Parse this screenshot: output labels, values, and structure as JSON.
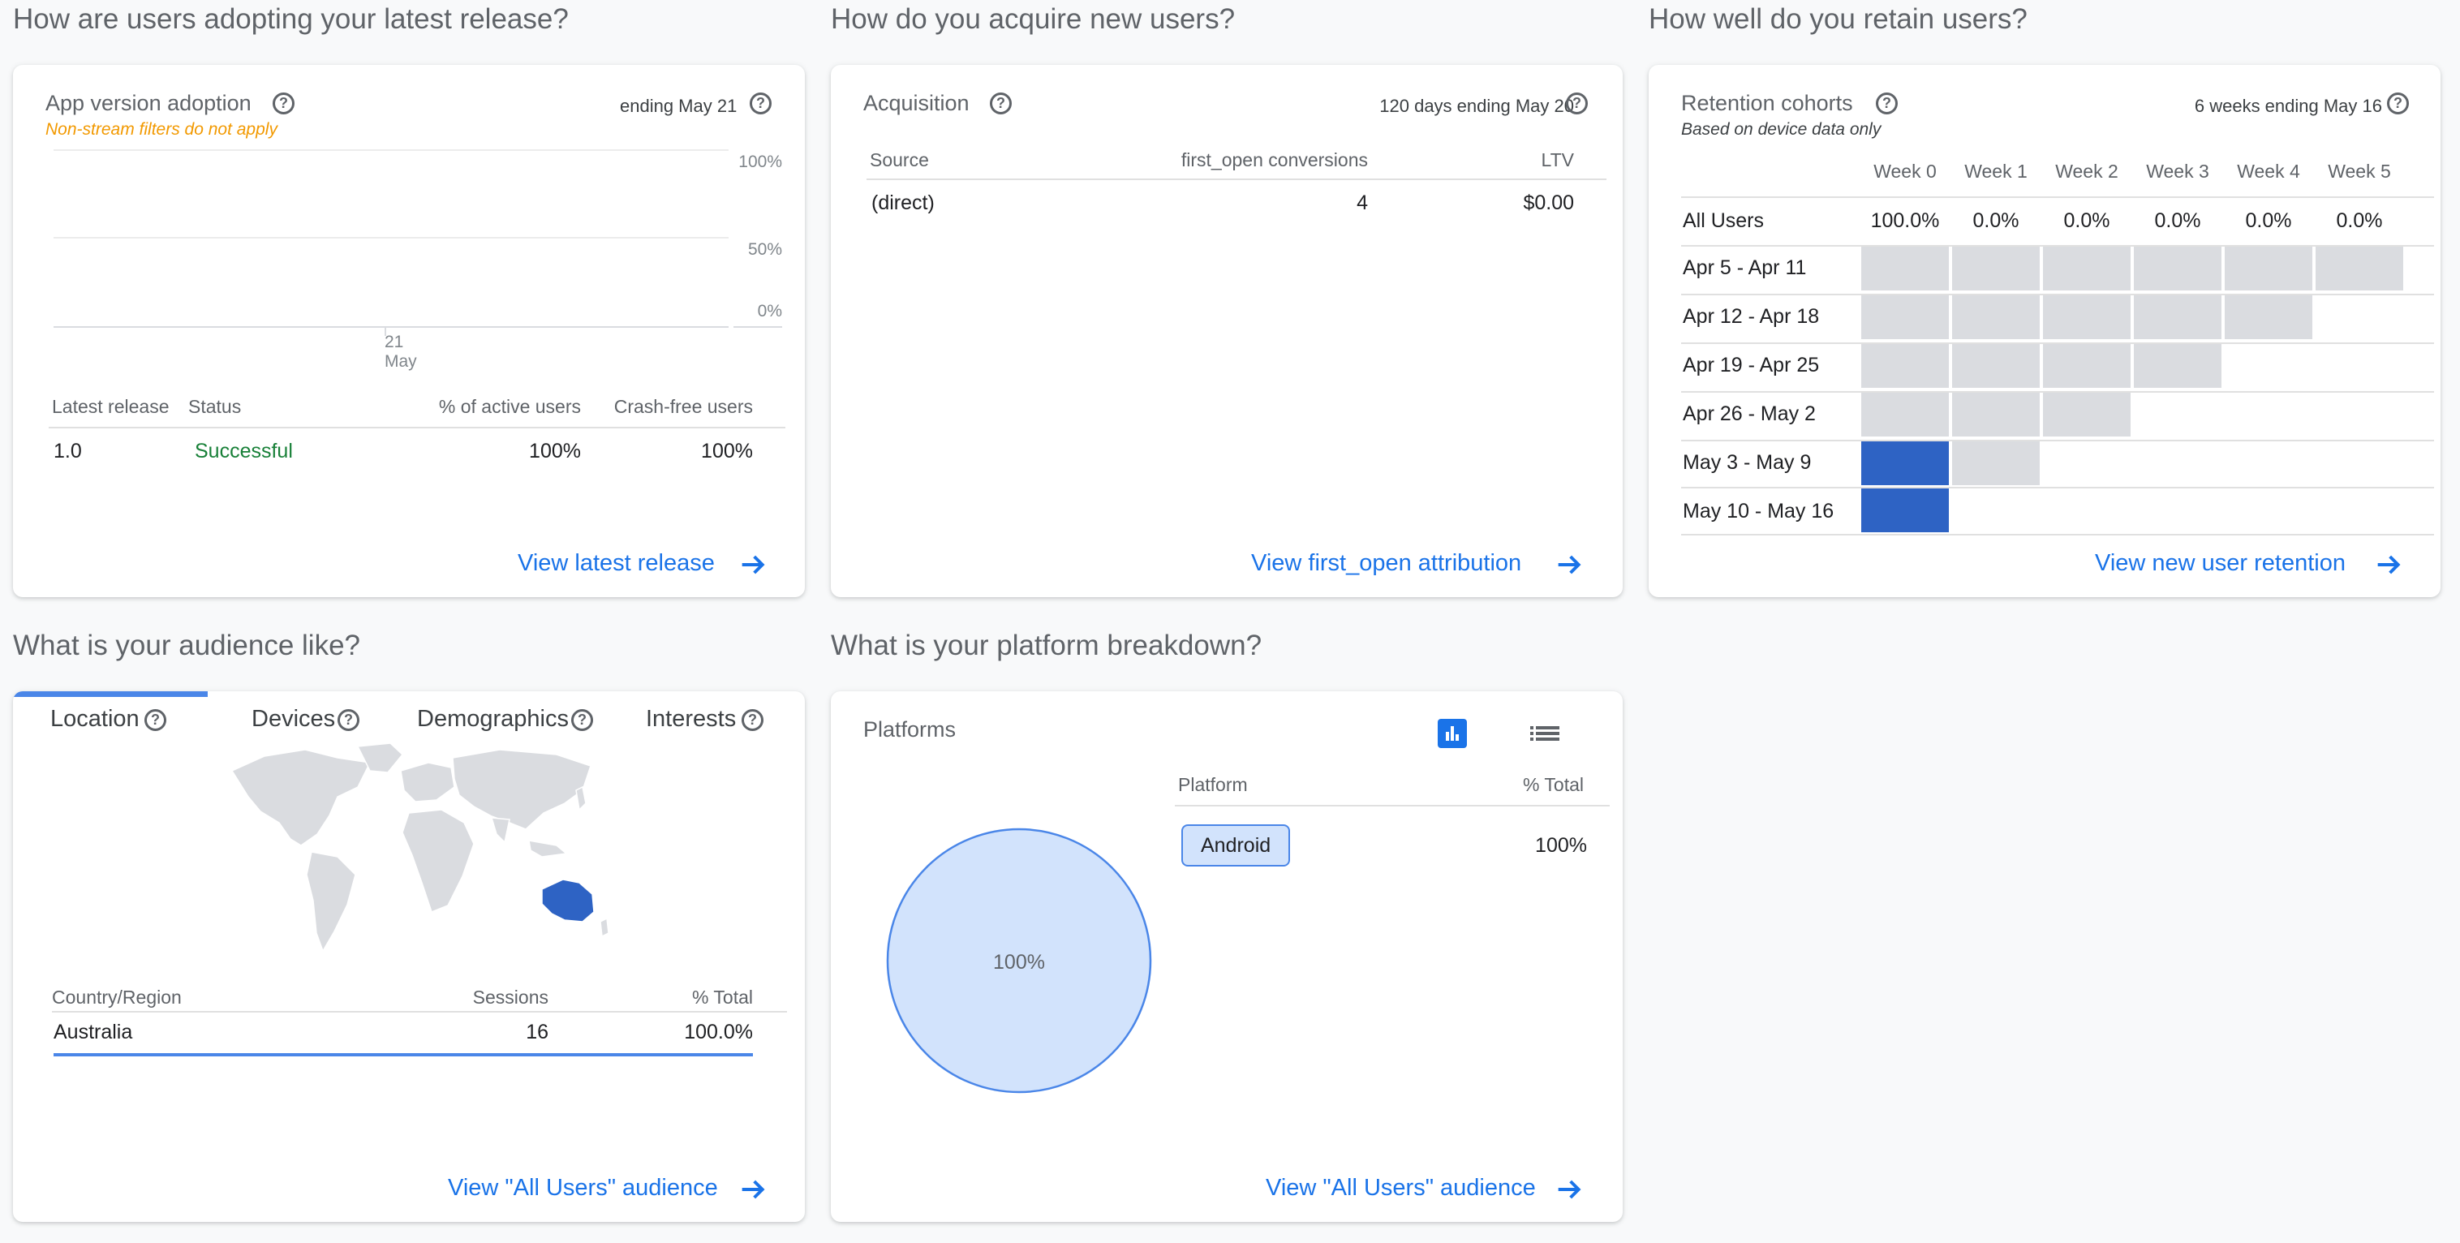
{
  "sections": {
    "adoption": "How are users adopting your latest release?",
    "acquisition": "How do you acquire new users?",
    "retention": "How well do you retain users?",
    "audience": "What is your audience like?",
    "platform": "What is your platform breakdown?"
  },
  "adoption_card": {
    "title": "App version adoption",
    "date": "ending May 21",
    "warning": "Non-stream filters do not apply",
    "y_ticks": [
      "100%",
      "50%",
      "0%"
    ],
    "x_tick_day": "21",
    "x_tick_month": "May",
    "columns": [
      "Latest release",
      "Status",
      "% of active users",
      "Crash-free users"
    ],
    "row": {
      "release": "1.0",
      "status": "Successful",
      "active": "100%",
      "crash_free": "100%"
    },
    "link": "View latest release",
    "colors": {
      "warning": "#f29900",
      "status_ok": "#188038"
    }
  },
  "acquisition_card": {
    "title": "Acquisition",
    "date": "120 days ending May 20",
    "columns": [
      "Source",
      "first_open conversions",
      "LTV"
    ],
    "row": {
      "source": "(direct)",
      "conversions": "4",
      "ltv": "$0.00"
    },
    "link": "View first_open attribution"
  },
  "retention_card": {
    "title": "Retention cohorts",
    "date": "6 weeks ending May 16",
    "subtitle": "Based on device data only",
    "weeks": [
      "Week 0",
      "Week 1",
      "Week 2",
      "Week 3",
      "Week 4",
      "Week 5"
    ],
    "all_users_label": "All Users",
    "all_users": [
      "100.0%",
      "0.0%",
      "0.0%",
      "0.0%",
      "0.0%",
      "0.0%"
    ],
    "cohorts": [
      {
        "label": "Apr 5 - Apr 11",
        "cells": [
          "grey",
          "grey",
          "grey",
          "grey",
          "grey",
          "grey"
        ]
      },
      {
        "label": "Apr 12 - Apr 18",
        "cells": [
          "grey",
          "grey",
          "grey",
          "grey",
          "grey"
        ]
      },
      {
        "label": "Apr 19 - Apr 25",
        "cells": [
          "grey",
          "grey",
          "grey",
          "grey"
        ]
      },
      {
        "label": "Apr 26 - May 2",
        "cells": [
          "grey",
          "grey",
          "grey"
        ]
      },
      {
        "label": "May 3 - May 9",
        "cells": [
          "blue",
          "grey"
        ]
      },
      {
        "label": "May 10 - May 16",
        "cells": [
          "blue"
        ]
      }
    ],
    "link": "View new user retention",
    "colors": {
      "filled": "#2e63c4",
      "empty": "#dadce0"
    }
  },
  "audience_card": {
    "tabs": [
      "Location",
      "Devices",
      "Demographics",
      "Interests"
    ],
    "active_tab": "Location",
    "columns": [
      "Country/Region",
      "Sessions",
      "% Total"
    ],
    "row": {
      "country": "Australia",
      "sessions": "16",
      "total": "100.0%"
    },
    "link": "View \"All Users\" audience",
    "colors": {
      "highlight": "#2e63c4",
      "land": "#dadce0"
    }
  },
  "platform_card": {
    "title": "Platforms",
    "columns": [
      "Platform",
      "% Total"
    ],
    "row": {
      "platform": "Android",
      "total": "100%"
    },
    "pie_label": "100%",
    "link": "View \"All Users\" audience",
    "icons": [
      "bar-chart-icon",
      "list-icon"
    ],
    "colors": {
      "pie_fill": "#d2e3fc",
      "pie_stroke": "#4a86e8"
    }
  },
  "chart_data": {
    "type": "pie",
    "categories": [
      "Android"
    ],
    "values": [
      100
    ]
  }
}
